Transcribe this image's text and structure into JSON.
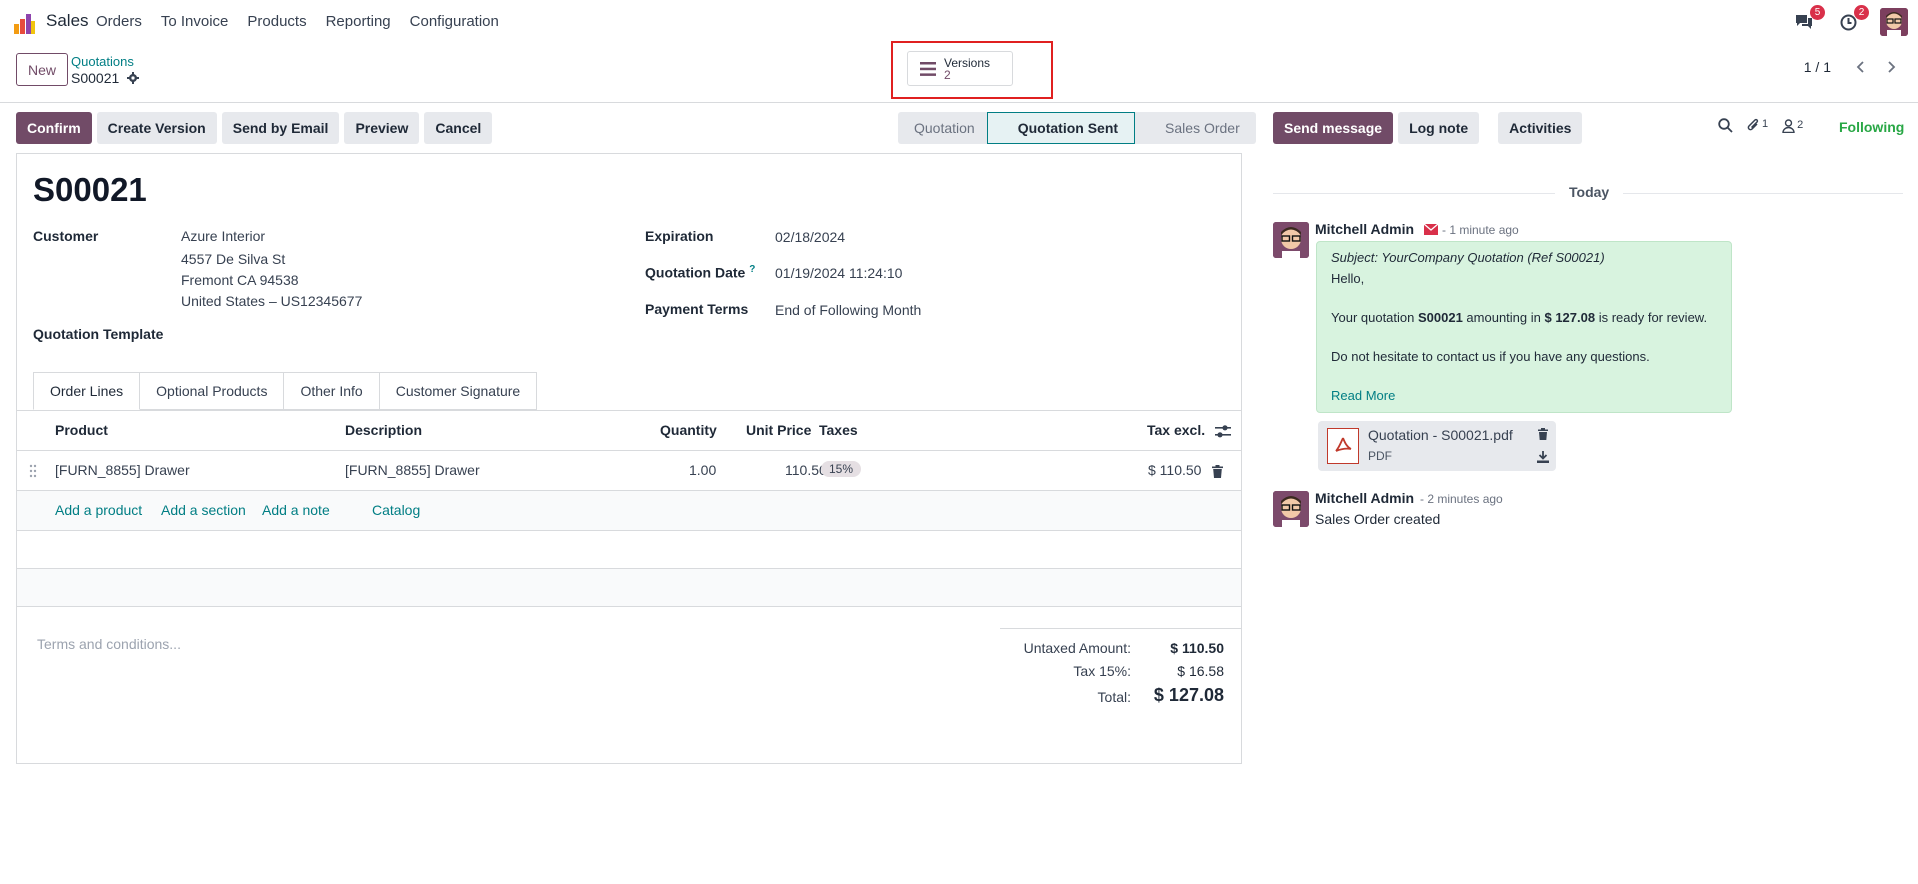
{
  "navbar": {
    "app_name": "Sales",
    "menu": [
      "Orders",
      "To Invoice",
      "Products",
      "Reporting",
      "Configuration"
    ],
    "messages_badge": "5",
    "activities_badge": "2"
  },
  "control": {
    "new_label": "New",
    "breadcrumb_parent": "Quotations",
    "breadcrumb_current": "S00021",
    "versions_label": "Versions",
    "versions_count": "2",
    "pager": "1 / 1"
  },
  "actions": {
    "confirm": "Confirm",
    "create_version": "Create Version",
    "send_email": "Send by Email",
    "preview": "Preview",
    "cancel": "Cancel"
  },
  "status": [
    "Quotation",
    "Quotation Sent",
    "Sales Order"
  ],
  "form": {
    "title": "S00021",
    "customer_label": "Customer",
    "customer_name": "Azure Interior",
    "customer_street": "4557 De Silva St",
    "customer_city": "Fremont CA 94538",
    "customer_country": "United States – US12345677",
    "template_label": "Quotation Template",
    "expiration_label": "Expiration",
    "expiration_value": "02/18/2024",
    "quotation_date_label": "Quotation Date",
    "quotation_date_help": "?",
    "quotation_date_value": "01/19/2024 11:24:10",
    "payment_terms_label": "Payment Terms",
    "payment_terms_value": "End of Following Month"
  },
  "tabs": [
    "Order Lines",
    "Optional Products",
    "Other Info",
    "Customer Signature"
  ],
  "order_lines": {
    "headers": {
      "product": "Product",
      "description": "Description",
      "quantity": "Quantity",
      "unit_price": "Unit Price",
      "taxes": "Taxes",
      "tax_excl": "Tax excl."
    },
    "rows": [
      {
        "product": "[FURN_8855] Drawer",
        "description": "[FURN_8855] Drawer",
        "quantity": "1.00",
        "unit_price": "110.50",
        "tax": "15%",
        "subtotal": "$ 110.50"
      }
    ],
    "add_product": "Add a product",
    "add_section": "Add a section",
    "add_note": "Add a note",
    "catalog": "Catalog"
  },
  "terms_placeholder": "Terms and conditions...",
  "totals": {
    "untaxed_label": "Untaxed Amount:",
    "untaxed_value": "$ 110.50",
    "tax_label": "Tax 15%:",
    "tax_value": "$ 16.58",
    "total_label": "Total:",
    "total_value": "$ 127.08"
  },
  "chatter": {
    "send_message": "Send message",
    "log_note": "Log note",
    "activities": "Activities",
    "attachments_count": "1",
    "followers_count": "2",
    "following": "Following",
    "today": "Today",
    "messages": [
      {
        "author": "Mitchell Admin",
        "time": "- 1 minute ago",
        "subject": "Subject: YourCompany Quotation (Ref S00021)",
        "greeting": "Hello,",
        "body_pre": "Your quotation ",
        "body_ref": "S00021",
        "body_mid": " amounting in ",
        "body_amount": "$ 127.08",
        "body_post": " is ready for review.",
        "body_contact": "Do not hesitate to contact us if you have any questions.",
        "read_more": "Read More",
        "attachment_name": "Quotation - S00021.pdf",
        "attachment_type": "PDF"
      },
      {
        "author": "Mitchell Admin",
        "time": "- 2 minutes ago",
        "body": "Sales Order created"
      }
    ]
  },
  "colors": {
    "brand": "#714b67",
    "link": "#017e84",
    "following": "#28a745",
    "highlight_frame": "#e02020"
  }
}
